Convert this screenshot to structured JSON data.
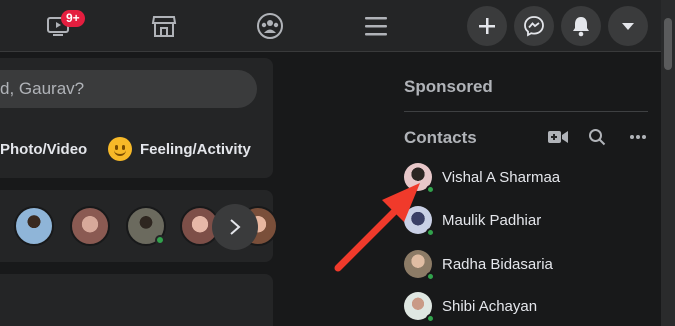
{
  "topbar": {
    "watch_badge": "9+"
  },
  "composer": {
    "placeholder": "d, Gaurav?",
    "photo_video_label": "Photo/Video",
    "feeling_label": "Feeling/Activity"
  },
  "sidebar": {
    "sponsored_heading": "Sponsored",
    "contacts_heading": "Contacts",
    "contacts": [
      {
        "name": "Vishal A Sharmaa",
        "online": true
      },
      {
        "name": "Maulik Padhiar",
        "online": true
      },
      {
        "name": "Radha Bidasaria",
        "online": true
      },
      {
        "name": "Shibi Achayan",
        "online": true
      }
    ]
  },
  "colors": {
    "background": "#18191a",
    "surface": "#242526",
    "online": "#31a24c",
    "annotation_arrow": "#f03a2b",
    "badge": "#e41e3f"
  },
  "icons": [
    "watch-icon",
    "marketplace-icon",
    "groups-icon",
    "menu-icon",
    "create-icon",
    "messenger-icon",
    "notifications-icon",
    "account-dropdown-icon",
    "new-room-icon",
    "search-icon",
    "more-options-icon",
    "chevron-right-icon",
    "feeling-icon"
  ]
}
